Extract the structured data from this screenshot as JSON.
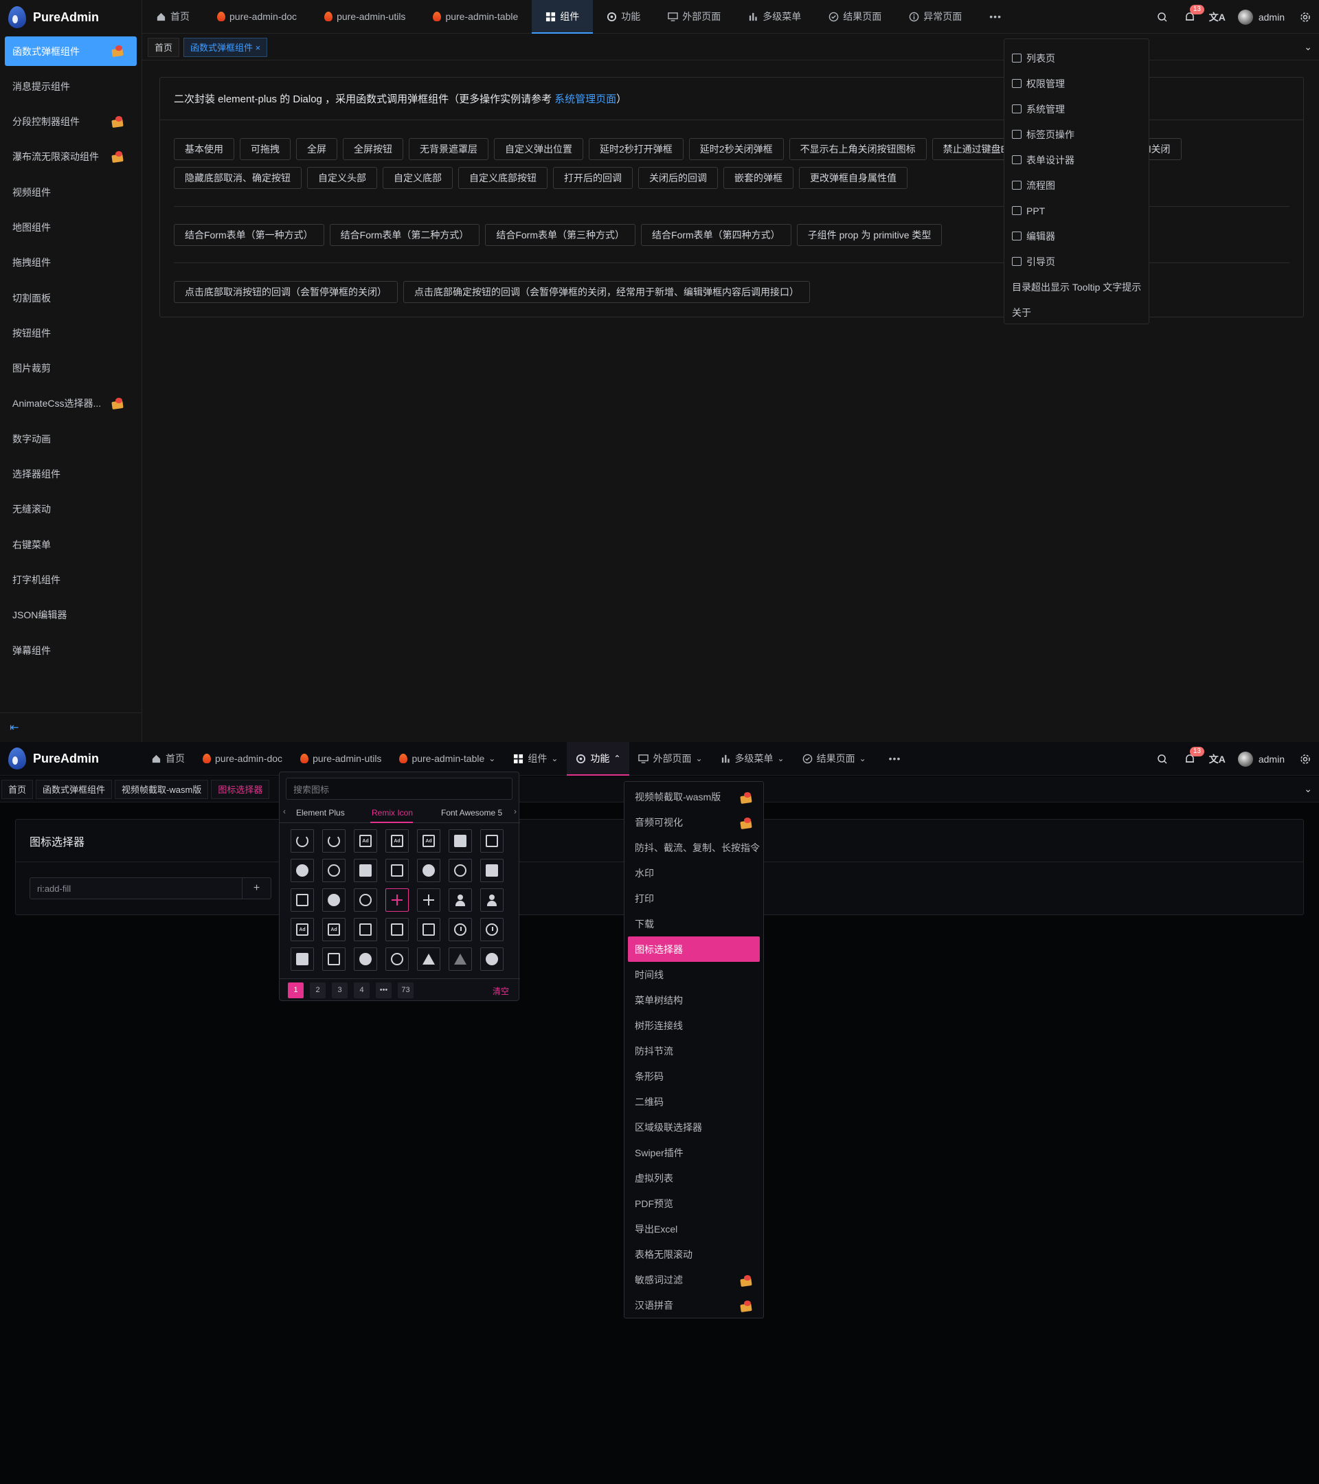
{
  "app": {
    "name": "PureAdmin"
  },
  "frame1": {
    "sidebar": {
      "items": [
        {
          "label": "函数式弹框组件",
          "active": true,
          "hot": true
        },
        {
          "label": "消息提示组件",
          "hot": false
        },
        {
          "label": "分段控制器组件",
          "hot": true
        },
        {
          "label": "瀑布流无限滚动组件",
          "hot": true
        },
        {
          "label": "视频组件",
          "hot": false
        },
        {
          "label": "地图组件",
          "hot": false
        },
        {
          "label": "拖拽组件",
          "hot": false
        },
        {
          "label": "切割面板",
          "hot": false
        },
        {
          "label": "按钮组件",
          "hot": false
        },
        {
          "label": "图片裁剪",
          "hot": false
        },
        {
          "label": "AnimateCss选择器...",
          "hot": true
        },
        {
          "label": "数字动画",
          "hot": false
        },
        {
          "label": "选择器组件",
          "hot": false
        },
        {
          "label": "无缝滚动",
          "hot": false
        },
        {
          "label": "右键菜单",
          "hot": false
        },
        {
          "label": "打字机组件",
          "hot": false
        },
        {
          "label": "JSON编辑器",
          "hot": false
        },
        {
          "label": "弹幕组件",
          "hot": false
        }
      ],
      "collapse_icon": "⇤"
    },
    "nav": [
      {
        "label": "首页",
        "icon": "home-icon"
      },
      {
        "label": "pure-admin-doc",
        "icon": "fire-icon"
      },
      {
        "label": "pure-admin-utils",
        "icon": "fire-icon"
      },
      {
        "label": "pure-admin-table",
        "icon": "fire-icon"
      },
      {
        "label": "组件",
        "icon": "grid-icon",
        "active": true
      },
      {
        "label": "功能",
        "icon": "settings-icon"
      },
      {
        "label": "外部页面",
        "icon": "monitor-icon"
      },
      {
        "label": "多级菜单",
        "icon": "bar-icon"
      },
      {
        "label": "结果页面",
        "icon": "check-icon"
      },
      {
        "label": "异常页面",
        "icon": "info-icon"
      }
    ],
    "more": "•••",
    "notice_count": "13",
    "user": "admin",
    "tags": [
      {
        "label": "首页"
      },
      {
        "label": "函数式弹框组件 ×",
        "active": true
      }
    ],
    "card": {
      "title_prefix": "二次封装 element-plus 的 Dialog ，采用函数式调用弹框组件（更多操作实例请参考",
      "title_link": "系统管理页面",
      "title_suffix": "）",
      "row1": [
        "基本使用",
        "可拖拽",
        "全屏",
        "全屏按钮",
        "无背景遮罩层",
        "自定义弹出位置",
        "延时2秒打开弹框",
        "延时2秒关闭弹框",
        "不显示右上角关闭按钮图标",
        "禁止通过键盘ESC关闭",
        "禁止通过点击modal关闭"
      ],
      "row2": [
        "隐藏底部取消、确定按钮",
        "自定义头部",
        "自定义底部",
        "自定义底部按钮",
        "打开后的回调",
        "关闭后的回调",
        "嵌套的弹框",
        "更改弹框自身属性值"
      ],
      "row3": [
        "结合Form表单（第一种方式）",
        "结合Form表单（第二种方式）",
        "结合Form表单（第三种方式）",
        "结合Form表单（第四种方式）",
        "子组件 prop 为 primitive 类型"
      ],
      "row4": [
        "点击底部取消按钮的回调（会暂停弹框的关闭）",
        "点击底部确定按钮的回调（会暂停弹框的关闭，经常用于新增、编辑弹框内容后调用接口）"
      ]
    },
    "more_menu": [
      "列表页",
      "权限管理",
      "系统管理",
      "标签页操作",
      "表单设计器",
      "流程图",
      "PPT",
      "编辑器",
      "引导页",
      "目录超出显示 Tooltip 文字提示",
      "关于"
    ]
  },
  "frame2": {
    "nav": [
      {
        "label": "首页",
        "icon": "home-icon"
      },
      {
        "label": "pure-admin-doc",
        "icon": "fire-icon"
      },
      {
        "label": "pure-admin-utils",
        "icon": "fire-icon"
      },
      {
        "label": "pure-admin-table",
        "icon": "fire-icon",
        "chevron": "⌄"
      },
      {
        "label": "组件",
        "icon": "grid-icon",
        "chevron": "⌄"
      },
      {
        "label": "功能",
        "icon": "settings-icon",
        "chevron": "⌃",
        "active": true
      },
      {
        "label": "外部页面",
        "icon": "monitor-icon",
        "chevron": "⌄"
      },
      {
        "label": "多级菜单",
        "icon": "bar-icon",
        "chevron": "⌄"
      },
      {
        "label": "结果页面",
        "icon": "check-icon",
        "chevron": "⌄"
      }
    ],
    "more": "•••",
    "notice_count": "13",
    "user": "admin",
    "tags": [
      {
        "label": "首页"
      },
      {
        "label": "函数式弹框组件"
      },
      {
        "label": "视频帧截取-wasm版"
      },
      {
        "label": "图标选择器",
        "pink": true
      }
    ],
    "card": {
      "title": "图标选择器",
      "input_value": "ri:add-fill",
      "plus": "+"
    },
    "picker": {
      "search_placeholder": "搜索图标",
      "tabs": [
        "Element Plus",
        "Remix Icon",
        "Font Awesome 5"
      ],
      "active_tab": "Remix Icon",
      "icons": [
        "rot",
        "rot",
        "ad",
        "ad",
        "ad",
        "f-square",
        "s-square",
        "f-circle",
        "s-circle",
        "f-square",
        "s-square",
        "f-circle",
        "s-circle",
        "f-square",
        "s-square",
        "f-circle",
        "s-circle",
        "plus-pink",
        "plus",
        "person",
        "person",
        "ad",
        "ad",
        "s-square",
        "s-square",
        "s-square",
        "alarm",
        "alarm",
        "f-square",
        "s-square",
        "f-circle",
        "s-circle",
        "tri",
        "tri-o",
        "f-circle"
      ],
      "pages": [
        "1",
        "2",
        "3",
        "4",
        "•••",
        "73"
      ],
      "clear": "清空"
    },
    "menu": [
      {
        "label": "视频帧截取-wasm版",
        "hot": true
      },
      {
        "label": "音频可视化",
        "hot": true
      },
      {
        "label": "防抖、截流、复制、长按指令"
      },
      {
        "label": "水印"
      },
      {
        "label": "打印"
      },
      {
        "label": "下载"
      },
      {
        "label": "图标选择器",
        "active": true
      },
      {
        "label": "时间线"
      },
      {
        "label": "菜单树结构"
      },
      {
        "label": "树形连接线"
      },
      {
        "label": "防抖节流"
      },
      {
        "label": "条形码"
      },
      {
        "label": "二维码"
      },
      {
        "label": "区域级联选择器"
      },
      {
        "label": "Swiper插件"
      },
      {
        "label": "虚拟列表"
      },
      {
        "label": "PDF预览"
      },
      {
        "label": "导出Excel"
      },
      {
        "label": "表格无限滚动"
      },
      {
        "label": "敏感词过滤",
        "hot": true
      },
      {
        "label": "汉语拼音",
        "hot": true
      }
    ]
  },
  "colors": {
    "primary": "#409eff",
    "accent_pink": "#e5328f",
    "badge": "#f56c6c"
  }
}
